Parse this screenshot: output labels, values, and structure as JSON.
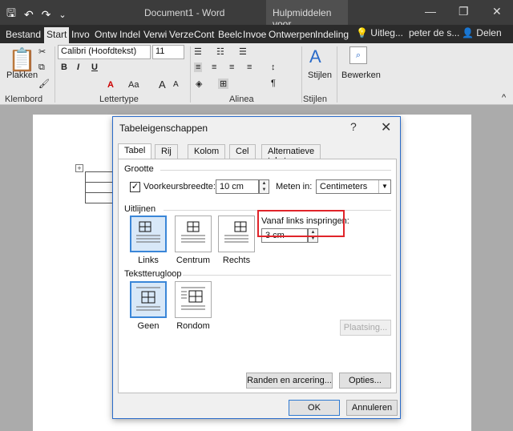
{
  "titlebar": {
    "doc_title": "Document1 - Word",
    "context_tab": "Hulpmiddelen voor...",
    "qat_save": "🖫",
    "qat_undo": "↶",
    "qat_redo": "↷",
    "qat_more": "⌄",
    "min": "—",
    "restore": "❐",
    "close": "✕"
  },
  "tabs": [
    {
      "label": "Bestand"
    },
    {
      "label": "Start"
    },
    {
      "label": "Invo"
    },
    {
      "label": "Ontw"
    },
    {
      "label": "Indel"
    },
    {
      "label": "Verwi"
    },
    {
      "label": "Verze"
    },
    {
      "label": "Cont"
    },
    {
      "label": "Beelc"
    },
    {
      "label": "Invoe"
    },
    {
      "label": "Ontwerpen"
    },
    {
      "label": "Indeling"
    }
  ],
  "tabs_right": {
    "tell": "Uitleg...",
    "user": "peter de s...",
    "share": "Delen"
  },
  "ribbon": {
    "paste": "Plakken",
    "font_name": "Calibri (Hoofdtekst)",
    "font_size": "11",
    "styles": "Stijlen",
    "editing": "Bewerken",
    "groups": {
      "clipboard": "Klembord",
      "font": "Lettertype",
      "paragraph": "Alinea",
      "styles": "Stijlen"
    },
    "bold": "B",
    "italic": "I",
    "underline": "U",
    "font_color": "A",
    "case": "Aa",
    "grow": "A",
    "shrink": "A",
    "pilcrow": "¶"
  },
  "dialog": {
    "title": "Tabeleigenschappen",
    "help": "?",
    "close": "✕",
    "tabs": [
      {
        "label": "Tabel"
      },
      {
        "label": "Rij"
      },
      {
        "label": "Kolom"
      },
      {
        "label": "Cel"
      },
      {
        "label": "Alternatieve tekst"
      }
    ],
    "size_section": "Grootte",
    "pref_width_label": "Voorkeursbreedte:",
    "pref_width_checked": "✓",
    "pref_width_value": "10 cm",
    "measure_label": "Meten in:",
    "measure_value": "Centimeters",
    "align_section": "Uitlijnen",
    "align_options": [
      {
        "label": "Links"
      },
      {
        "label": "Centrum"
      },
      {
        "label": "Rechts"
      }
    ],
    "indent_label": "Vanaf links inspringen:",
    "indent_value": "3 cm",
    "wrap_section": "Tekstterugloop",
    "wrap_options": [
      {
        "label": "Geen"
      },
      {
        "label": "Rondom"
      }
    ],
    "positioning_button": "Plaatsing...",
    "borders_button": "Randen en arcering...",
    "options_button": "Opties...",
    "ok_button": "OK",
    "cancel_button": "Annuleren"
  },
  "colors": {
    "accent": "#2a6bc9",
    "highlight": "#e0242a",
    "titlebar": "#3c3c3c",
    "ribbon": "#e9e9e9"
  }
}
